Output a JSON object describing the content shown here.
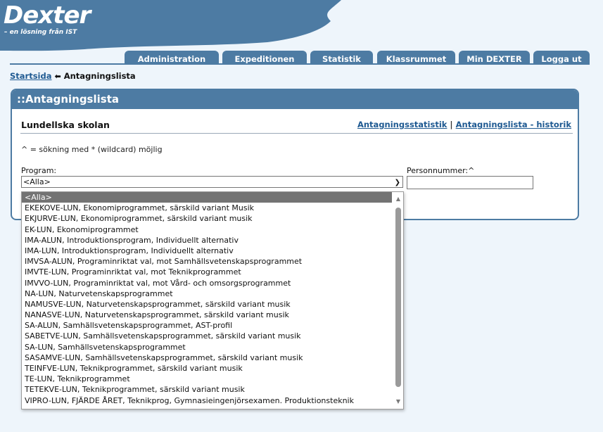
{
  "logo": {
    "name": "Dexter",
    "tagline": "– en lösning från IST"
  },
  "nav": {
    "tabs": [
      "Administration",
      "Expeditionen",
      "Statistik",
      "Klassrummet",
      "Min DEXTER",
      "Logga ut"
    ]
  },
  "breadcrumb": {
    "home": "Startsida",
    "current": "Antagningslista"
  },
  "panel": {
    "title": "::Antagningslista",
    "school": "Lundellska skolan",
    "links": [
      "Antagningsstatistik",
      "Antagningslista - historik"
    ],
    "separator": "|",
    "hint": "^ = sökning med * (wildcard) möjlig",
    "program_label": "Program:",
    "program_value": "<Alla>",
    "personnummer_label": "Personnummer:^",
    "personnummer_value": ""
  },
  "dropdown": {
    "options": [
      "<Alla>",
      "EKEKOVE-LUN, Ekonomiprogrammet, särskild variant Musik",
      "EKJURVE-LUN, Ekonomiprogrammet, särskild variant musik",
      "EK-LUN, Ekonomiprogrammet",
      "IMA-ALUN, Introduktionsprogram, Individuellt alternativ",
      "IMA-LUN, Introduktionsprogram, Individuellt alternativ",
      "IMVSA-ALUN, Programinriktat val, mot Samhällsvetenskapsprogrammet",
      "IMVTE-LUN, Programinriktat val, mot Teknikprogrammet",
      "IMVVO-LUN, Programinriktat val, mot Vård- och omsorgsprogrammet",
      "NA-LUN, Naturvetenskapsprogrammet",
      "NAMUSVE-LUN, Naturvetenskapsprogrammet, särskild variant musik",
      "NANASVE-LUN, Naturvetenskapsprogrammet, särskild variant musik",
      "SA-ALUN, Samhällsvetenskapsprogrammet, AST-profil",
      "SABETVE-LUN, Samhällsvetenskapsprogrammet, särskild variant musik",
      "SA-LUN, Samhällsvetenskapsprogrammet",
      "SASAMVE-LUN, Samhällsvetenskapsprogrammet, särskild variant musik",
      "TEINFVE-LUN, Teknikprogrammet, särskild variant musik",
      "TE-LUN, Teknikprogrammet",
      "TETEKVE-LUN, Teknikprogrammet, särskild variant musik",
      "VIPRO-LUN, FJÄRDE ÅRET, Teknikprog, Gymnasieingenjörsexamen. Produktionsteknik"
    ],
    "selected_index": 0
  },
  "colors": {
    "accent": "#4d7ba3",
    "link": "#1f5a92",
    "page_bg": "#eef5fb"
  }
}
